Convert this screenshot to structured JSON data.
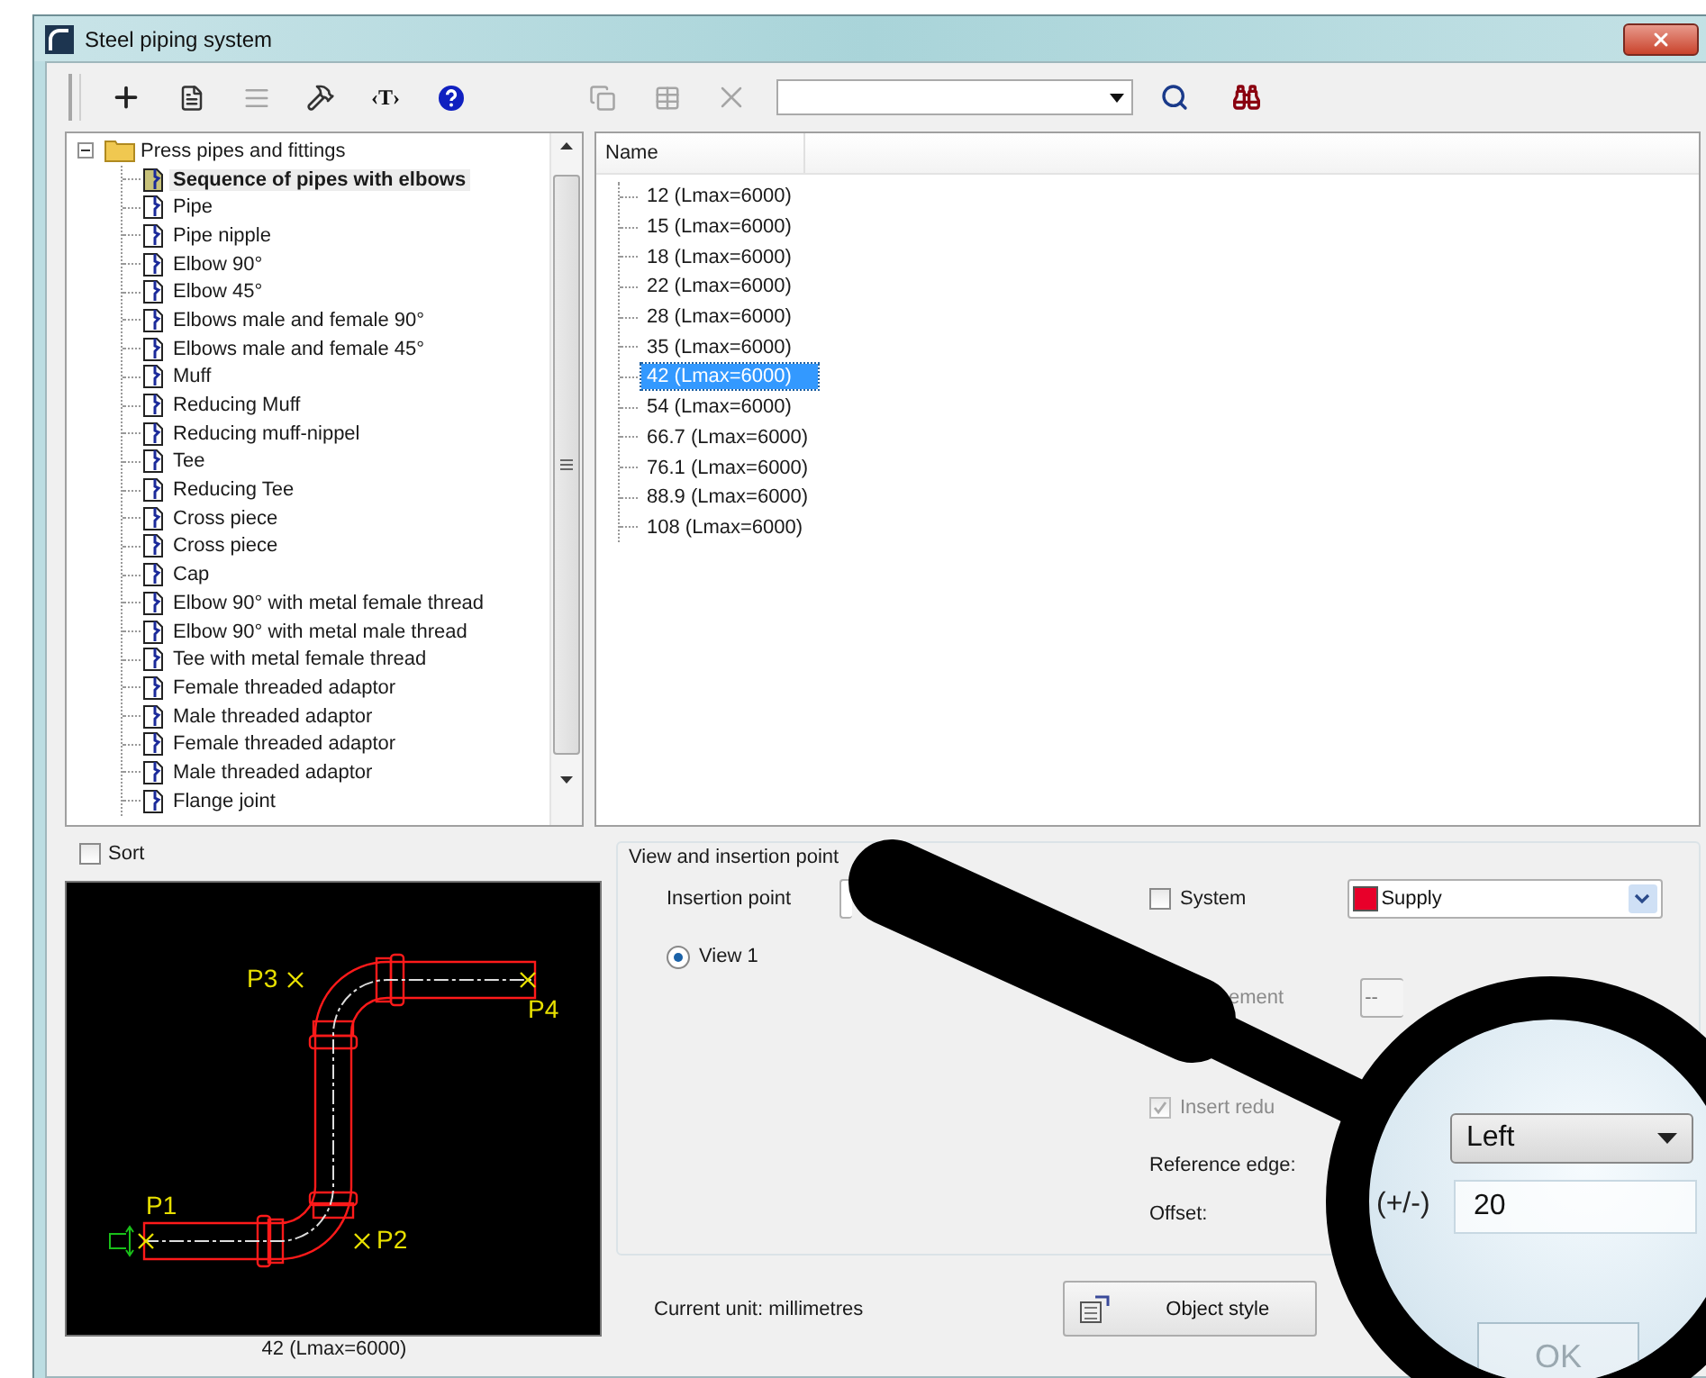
{
  "window": {
    "title": "Steel piping system"
  },
  "toolbar": [
    {
      "kind": "add",
      "disabled": false
    },
    {
      "kind": "properties",
      "disabled": false
    },
    {
      "kind": "list",
      "disabled": true
    },
    {
      "kind": "tools",
      "disabled": false
    },
    {
      "kind": "text",
      "disabled": false,
      "glyph": "‹T›"
    },
    {
      "kind": "help",
      "disabled": false
    },
    {
      "kind": "copy",
      "disabled": true
    },
    {
      "kind": "table",
      "disabled": true
    },
    {
      "kind": "delete",
      "disabled": true
    }
  ],
  "tree": {
    "label": "Press pipes and fittings",
    "expanded": true,
    "children": [
      {
        "label": "Sequence of pipes with elbows",
        "selected": true
      },
      {
        "label": "Pipe",
        "selected": false
      },
      {
        "label": "Pipe nipple",
        "selected": false
      },
      {
        "label": "Elbow 90°",
        "selected": false
      },
      {
        "label": "Elbow 45°",
        "selected": false
      },
      {
        "label": "Elbows male and female 90°",
        "selected": false
      },
      {
        "label": "Elbows male and female 45°",
        "selected": false
      },
      {
        "label": "Muff",
        "selected": false
      },
      {
        "label": "Reducing Muff",
        "selected": false
      },
      {
        "label": "Reducing muff-nippel",
        "selected": false
      },
      {
        "label": "Tee",
        "selected": false
      },
      {
        "label": "Reducing Tee",
        "selected": false
      },
      {
        "label": "Cross piece",
        "selected": false
      },
      {
        "label": "Cross piece",
        "selected": false
      },
      {
        "label": "Cap",
        "selected": false
      },
      {
        "label": "Elbow 90° with metal female thread",
        "selected": false
      },
      {
        "label": "Elbow 90° with metal male thread",
        "selected": false
      },
      {
        "label": "Tee with metal female thread",
        "selected": false
      },
      {
        "label": "Female threaded adaptor",
        "selected": false
      },
      {
        "label": "Male threaded adaptor",
        "selected": false
      },
      {
        "label": "Female threaded adaptor",
        "selected": false
      },
      {
        "label": "Male threaded adaptor",
        "selected": false
      },
      {
        "label": "Flange joint",
        "selected": false
      }
    ]
  },
  "sizes": {
    "column": "Name",
    "rows": [
      {
        "label": "12 (Lmax=6000)",
        "selected": false
      },
      {
        "label": "15 (Lmax=6000)",
        "selected": false
      },
      {
        "label": "18 (Lmax=6000)",
        "selected": false
      },
      {
        "label": "22 (Lmax=6000)",
        "selected": false
      },
      {
        "label": "28 (Lmax=6000)",
        "selected": false
      },
      {
        "label": "35 (Lmax=6000)",
        "selected": false
      },
      {
        "label": "42 (Lmax=6000)",
        "selected": true
      },
      {
        "label": "54 (Lmax=6000)",
        "selected": false
      },
      {
        "label": "66.7 (Lmax=6000)",
        "selected": false
      },
      {
        "label": "76.1 (Lmax=6000)",
        "selected": false
      },
      {
        "label": "88.9 (Lmax=6000)",
        "selected": false
      },
      {
        "label": "108 (Lmax=6000)",
        "selected": false
      }
    ]
  },
  "sort": {
    "label": "Sort",
    "checked": false
  },
  "preview": {
    "points": [
      "P1",
      "P2",
      "P3",
      "P4"
    ],
    "caption": "42 (Lmax=6000)"
  },
  "insertion": {
    "title": "View and insertion point",
    "point_label": "Insertion point",
    "views": [
      {
        "label": "View 1",
        "selected": true
      }
    ],
    "system": {
      "label": "System",
      "checked": false
    },
    "system_value": {
      "value": "Supply",
      "color": "#e8002a"
    },
    "element_label": "ement",
    "element_value": "--",
    "insert_reducer": {
      "label": "Insert redu",
      "checked": true,
      "disabled": true
    },
    "reference_label": "Reference edge:",
    "offset_label": "Offset:"
  },
  "footer": {
    "unit": "Current unit: millimetres",
    "object_style": "Object style"
  },
  "magnifier": {
    "reference_value": "Left",
    "offset_prefix": "(+/-)",
    "offset_value": "20",
    "ok_label": "OK"
  }
}
